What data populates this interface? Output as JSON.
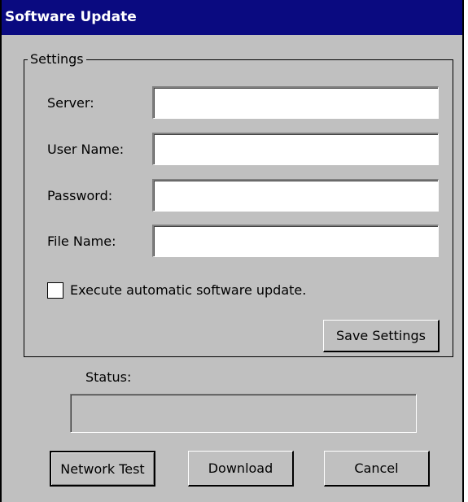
{
  "window": {
    "title": "Software Update"
  },
  "settings": {
    "group_label": "Settings",
    "fields": [
      {
        "label": "Server:",
        "value": ""
      },
      {
        "label": "User Name:",
        "value": ""
      },
      {
        "label": "Password:",
        "value": ""
      },
      {
        "label": "File Name:",
        "value": ""
      }
    ],
    "auto_update": {
      "label": "Execute automatic software update.",
      "checked": false
    },
    "save_label": "Save Settings"
  },
  "status": {
    "label": "Status:",
    "text": ""
  },
  "buttons": {
    "network_test": "Network Test",
    "download": "Download",
    "cancel": "Cancel"
  }
}
